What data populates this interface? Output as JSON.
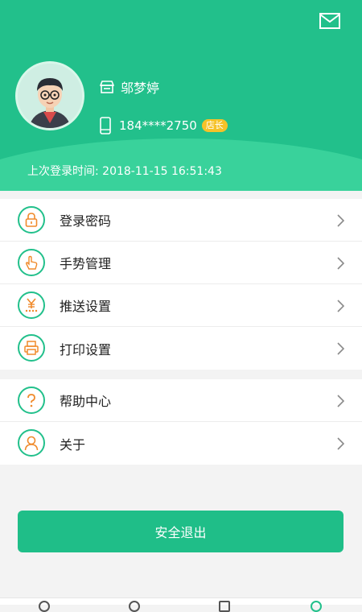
{
  "profile": {
    "name": "邬梦婷",
    "phone": "184****2750",
    "role_badge": "店长",
    "last_login_label": "上次登录时间:",
    "last_login_time": "2018-11-15 16:51:43"
  },
  "menu_group_1": [
    {
      "label": "登录密码",
      "icon": "lock-icon"
    },
    {
      "label": "手势管理",
      "icon": "gesture-hand-icon"
    },
    {
      "label": "推送设置",
      "icon": "yuan-push-icon"
    },
    {
      "label": "打印设置",
      "icon": "printer-icon"
    }
  ],
  "menu_group_2": [
    {
      "label": "帮助中心",
      "icon": "question-icon"
    },
    {
      "label": "关于",
      "icon": "person-icon"
    }
  ],
  "logout_label": "安全退出",
  "colors": {
    "primary": "#22c08b",
    "accent_orange": "#f08a2b",
    "badge_yellow": "#f5c229"
  }
}
